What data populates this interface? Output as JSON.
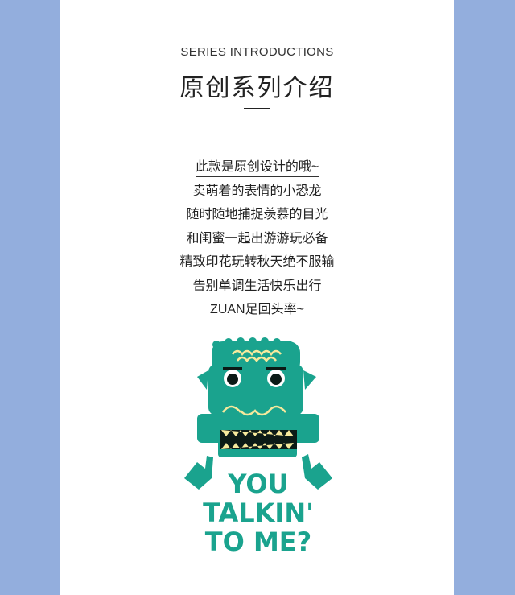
{
  "colors": {
    "side_panel": "#93aedd",
    "page": "#ffffff",
    "mascot_teal": "#1aa38e",
    "mascot_dark": "#0b1a16",
    "mascot_accent": "#f6e99c",
    "text": "#222222"
  },
  "header": {
    "eyebrow": "SERIES INTRODUCTIONS",
    "title": "原创系列介绍"
  },
  "intro_lines": [
    "此款是原创设计的哦~",
    "卖萌着的表情的小恐龙",
    "随时随地捕捉羡慕的目光",
    "和闺蜜一起出游游玩必备",
    "精致印花玩转秋天绝不服输",
    "告别单调生活快乐出行",
    "ZUAN足回头率~"
  ],
  "artwork": {
    "icon": "dinosaur-mascot-illustration",
    "slogan": [
      "YOU",
      "TALKIN'",
      "TO ME?"
    ]
  }
}
